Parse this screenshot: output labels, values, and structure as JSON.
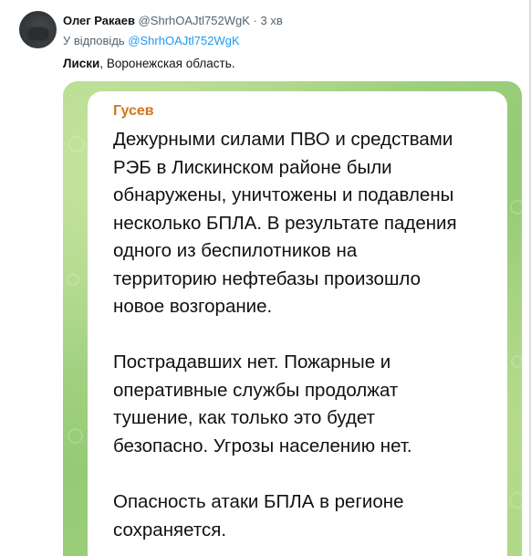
{
  "tweet": {
    "author_name": "Олег Ракаев",
    "author_handle": "@ShrhOAJtl752WgK",
    "separator": "·",
    "time_ago": "3 хв",
    "reply_prefix": "У відповідь",
    "reply_handle": "@ShrhOAJtl752WgK",
    "text_bold": "Лиски",
    "text_rest": ", Воронежская область."
  },
  "message": {
    "sender": "Гусев",
    "paragraph_1": [
      "Дежурными силами ПВО и средствами",
      "РЭБ в Лискинском районе были",
      "обнаружены, уничтожены и подавлены",
      "несколько БПЛА. В результате падения",
      "одного из беспилотников на",
      "территорию нефтебазы произошло",
      "новое возгорание."
    ],
    "paragraph_2": [
      "Пострадавших нет. Пожарные и",
      "оперативные службы продолжат",
      "тушение, как только это будет",
      "безопасно. Угрозы населению нет."
    ],
    "paragraph_3": [
      "Опасность атаки БПЛА в регионе",
      "сохраняется."
    ]
  },
  "colors": {
    "handle_gray": "#536471",
    "link_blue": "#1d9bf0",
    "sender_orange": "#d4751b",
    "chat_background_green": "#98cd78"
  }
}
